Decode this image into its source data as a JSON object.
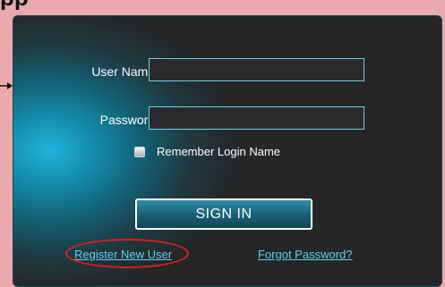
{
  "page": {
    "top_fragment": "pp"
  },
  "login": {
    "username_label": "User Name:",
    "username_value": "",
    "password_label": "Password:",
    "password_value": "",
    "remember_label": "Remember Login Name",
    "remember_checked": false,
    "signin_label": "SIGN IN",
    "register_link": "Register New User",
    "forgot_link": "Forgot Password?"
  },
  "annotation": {
    "highlight": "register-new-user",
    "highlight_color": "#d91f1f"
  },
  "colors": {
    "page_background": "#eaa9ad",
    "panel_background": "#242628",
    "accent": "#1fb4dc",
    "field_border": "#6ad1e8",
    "link_color": "#5fd0f0"
  },
  "icons": [
    "pointer-arrow-icon",
    "checkbox-icon"
  ]
}
